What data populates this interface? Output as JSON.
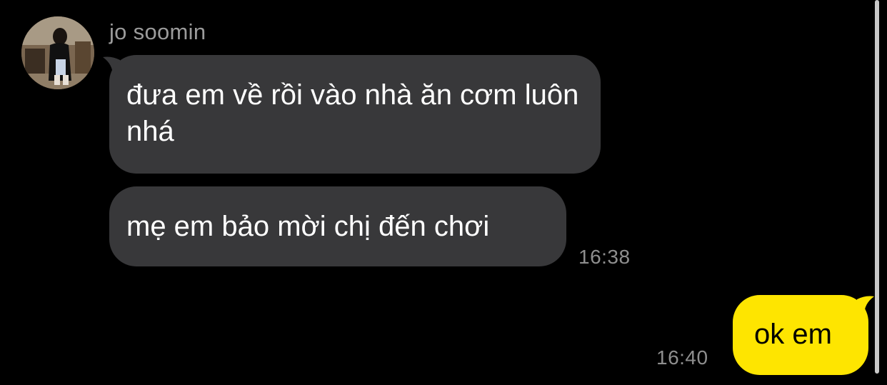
{
  "conversation": {
    "sender": {
      "name": "jo soomin"
    },
    "incoming_messages": [
      {
        "text": "đưa em về rồi vào nhà ăn cơm luôn nhá"
      },
      {
        "text": "mẹ em bảo mời chị đến chơi"
      }
    ],
    "incoming_time": "16:38",
    "outgoing_message": {
      "text": "ok em"
    },
    "outgoing_time": "16:40"
  },
  "colors": {
    "background": "#000000",
    "incoming_bubble": "#38383a",
    "outgoing_bubble": "#fee500",
    "timestamp": "#8e8e8e",
    "sender_name": "#9b9b9b"
  }
}
